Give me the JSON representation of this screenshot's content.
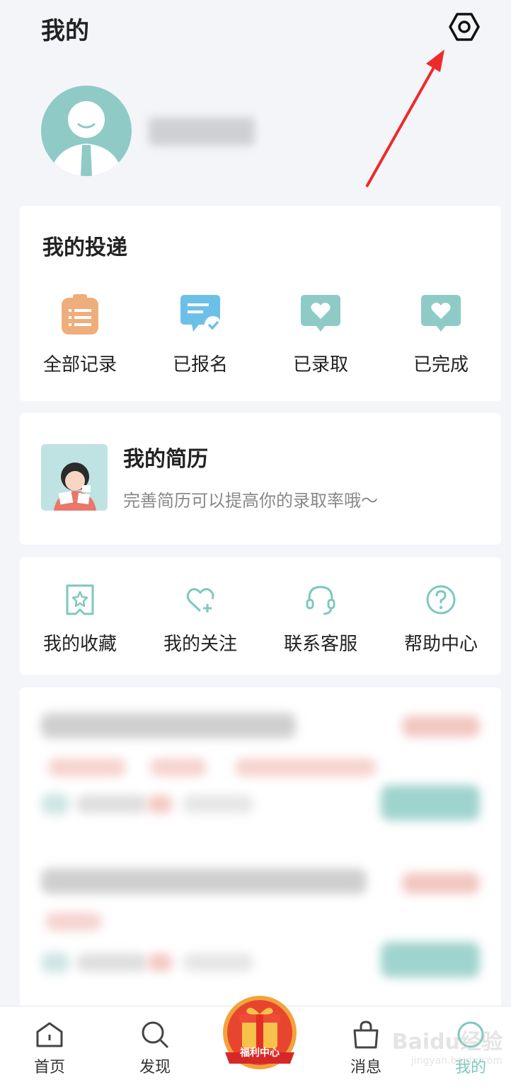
{
  "header": {
    "title": "我的"
  },
  "profile": {
    "username": ""
  },
  "delivery": {
    "title": "我的投递",
    "items": [
      {
        "label": "全部记录",
        "icon": "clipboard-icon",
        "color": "#eeae7c"
      },
      {
        "label": "已报名",
        "icon": "chat-check-icon",
        "color": "#6cc0e8"
      },
      {
        "label": "已录取",
        "icon": "heart-bubble-icon",
        "color": "#8fcbc6"
      },
      {
        "label": "已完成",
        "icon": "heart-bubble-icon",
        "color": "#8fcbc6"
      }
    ]
  },
  "resume": {
    "title": "我的简历",
    "subtitle": "完善简历可以提高你的录取率哦～"
  },
  "tools": {
    "items": [
      {
        "label": "我的收藏",
        "icon": "star-badge-icon"
      },
      {
        "label": "我的关注",
        "icon": "heart-plus-icon"
      },
      {
        "label": "联系客服",
        "icon": "headset-icon"
      },
      {
        "label": "帮助中心",
        "icon": "help-circle-icon"
      }
    ]
  },
  "tabbar": {
    "items": [
      {
        "label": "首页",
        "icon": "home-icon"
      },
      {
        "label": "发现",
        "icon": "search-icon"
      },
      {
        "label": "消息",
        "icon": "bag-icon"
      },
      {
        "label": "我的",
        "icon": "profile-circle-icon"
      }
    ],
    "center": {
      "label": "福利中心",
      "icon": "gift-icon"
    }
  },
  "watermark": {
    "text": "Baidu经验",
    "sub": "jingyan.baidu.com"
  },
  "colors": {
    "accent": "#7dc8c0",
    "arrow": "#ee2a2a",
    "background": "#f4f5f9"
  }
}
